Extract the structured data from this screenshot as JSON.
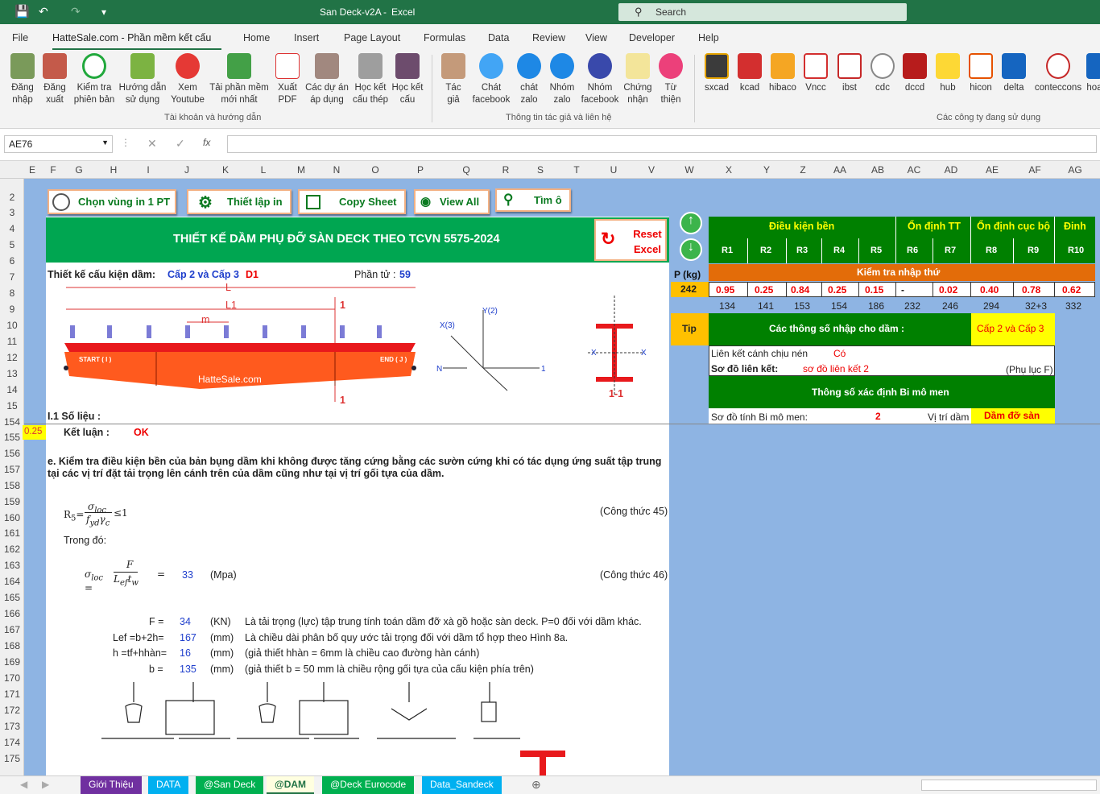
{
  "titlebar": {
    "doc_title": "San Deck-v2A",
    "sep": "-",
    "app_name": "Excel",
    "search_placeholder": "Search"
  },
  "menu": [
    "File",
    "HatteSale.com - Phần mềm kết cấu",
    "Home",
    "Insert",
    "Page Layout",
    "Formulas",
    "Data",
    "Review",
    "View",
    "Developer",
    "Help"
  ],
  "ribbon": {
    "group1": [
      "Đăng nhập",
      "Đăng xuất",
      "Kiểm tra phiên bản",
      "Hướng dẫn sử dụng",
      "Xem Youtube",
      "Tải phần mềm mới nhất",
      "Xuất PDF",
      "Các dự án áp dụng",
      "Học kết cấu thép",
      "Học kết cấu"
    ],
    "group1_label": "Tài khoản và hướng dẫn",
    "group2": [
      "Tác giả",
      "Chát facebook",
      "chát zalo",
      "Nhóm zalo",
      "Nhóm facebook",
      "Chứng nhận",
      "Từ thiện"
    ],
    "group2_label": "Thông tin tác giả và liên hệ",
    "group3": [
      "sxcad",
      "kcad",
      "hibaco",
      "Vncc",
      "ibst",
      "cdc",
      "dccd",
      "hub",
      "hicon",
      "delta",
      "conteccons",
      "hoa"
    ],
    "group3_label": "Các công ty đang sử dụng"
  },
  "formula": {
    "namebox": "AE76",
    "fx": "fx",
    "value": ""
  },
  "columns": [
    "E",
    "F",
    "G",
    "H",
    "I",
    "J",
    "K",
    "L",
    "M",
    "N",
    "O",
    "P",
    "Q",
    "R",
    "S",
    "T",
    "U",
    "V",
    "W",
    "X",
    "Y",
    "Z",
    "AA",
    "AB",
    "AC",
    "AD",
    "AE",
    "AF",
    "AG"
  ],
  "rows": [
    "2",
    "3",
    "4",
    "5",
    "6",
    "7",
    "8",
    "9",
    "10",
    "11",
    "12",
    "13",
    "14",
    "15",
    "154",
    "155",
    "156",
    "157",
    "158",
    "159",
    "160",
    "161",
    "162",
    "163",
    "164",
    "165",
    "166",
    "167",
    "168",
    "169",
    "170",
    "171",
    "172",
    "173",
    "174",
    "175"
  ],
  "buttons": {
    "print": "Chọn vùng in 1 PT",
    "setup": "Thiết lập in",
    "copy": "Copy Sheet",
    "viewall": "View All",
    "find": "Tìm ô",
    "reset": "Reset Excel"
  },
  "main": {
    "title": "THIẾT KẾ DẦM PHỤ ĐỠ SÀN DECK THEO TCVN 5575-2024",
    "design_label": "Thiết kế cấu kiện dầm:",
    "design_value": "Cấp 2 và Cấp 3",
    "design_code": "D1",
    "element_label": "Phần tử :",
    "element_value": "59",
    "sec_data": "I.1   Số liệu :",
    "row154_val": "0.25",
    "conclusion_label": "Kết luận :",
    "conclusion_value": "OK",
    "para_e": "e.  Kiểm tra điều kiện bền của bản bụng dầm khi không được tăng cứng bằng các sườn cứng khi có tác dụng ứng suất tập trung tại các vị trí đặt tải trọng lên cánh trên của dầm cũng như tại vị trí gối tựa của dầm.",
    "formula45": "(Công thức 45)",
    "trong_do": "Trong đó:",
    "sigma_val": "33",
    "sigma_unit": "(Mpa)",
    "formula46": "(Công thức 46)",
    "rows": [
      {
        "lbl": "F =",
        "val": "34",
        "unit": "(KN)",
        "desc": "Là tải trọng (lực) tập trung tính toán dầm đỡ xà gồ hoặc sàn deck. P=0 đối với dầm khác."
      },
      {
        "lbl": "Lef =b+2h=",
        "val": "167",
        "unit": "(mm)",
        "desc": "Là chiều dài phân bố quy ước tải trọng đối với dầm tổ hợp theo Hình 8a."
      },
      {
        "lbl": "h =tf+hhàn=",
        "val": "16",
        "unit": "(mm)",
        "desc": "(giả thiết hhàn = 6mm là chiều cao đường hàn cánh)"
      },
      {
        "lbl": "b =",
        "val": "135",
        "unit": "(mm)",
        "desc": "(giả thiết b = 50 mm là chiều rộng gối tựa của cấu kiện phía trên)"
      }
    ],
    "beam_labels": {
      "L": "L",
      "L1": "L1",
      "m": "m",
      "start": "START ( I )",
      "end": "END ( J )",
      "brand": "HatteSale.com",
      "s1": "1",
      "s2": "1",
      "sec": "1-1"
    }
  },
  "right": {
    "hdr": [
      "Điều kiện bền",
      "Ổn định TT",
      "Ổn định cục bộ",
      "Đinh"
    ],
    "r_labels": [
      "R1",
      "R2",
      "R3",
      "R4",
      "R5",
      "R6",
      "R7",
      "R8",
      "R9",
      "R10"
    ],
    "p_label": "P (kg)",
    "p_value": "242",
    "check_label": "Kiểm tra nhập thứ",
    "values": [
      "0.95",
      "0.25",
      "0.84",
      "0.25",
      "0.15",
      "-",
      "0.02",
      "0.40",
      "0.78",
      "0.62"
    ],
    "refs": [
      "134",
      "141",
      "153",
      "154",
      "186",
      "232",
      "246",
      "294",
      "32+3",
      "332"
    ],
    "tip": "Tip",
    "params_title": "Các thông số nhập cho dầm :",
    "params_badge": "Cấp 2 và Cấp 3",
    "compress_label": "Liên kết cánh chịu nén",
    "compress_value": "Có",
    "conn_label": "Sơ đồ liên kết:",
    "conn_value": "sơ đồ liên kết 2",
    "appendix": "(Phụ lục F)",
    "bi_title": "Thông số xác định Bi mô men",
    "bi_label": "Sơ đồ tính Bi mô men:",
    "bi_value": "2",
    "pos_label": "Vị trí dầm",
    "pos_value": "Dầm đỡ sàn"
  },
  "tabs": [
    "Giới Thiệu",
    "DATA",
    "@San Deck",
    "@DAM",
    "@Deck Eurocode",
    "Data_Sandeck"
  ],
  "colors": {
    "excel_green": "#217346",
    "sheet_bg": "#8eb4e3",
    "title_green": "#00a651"
  }
}
